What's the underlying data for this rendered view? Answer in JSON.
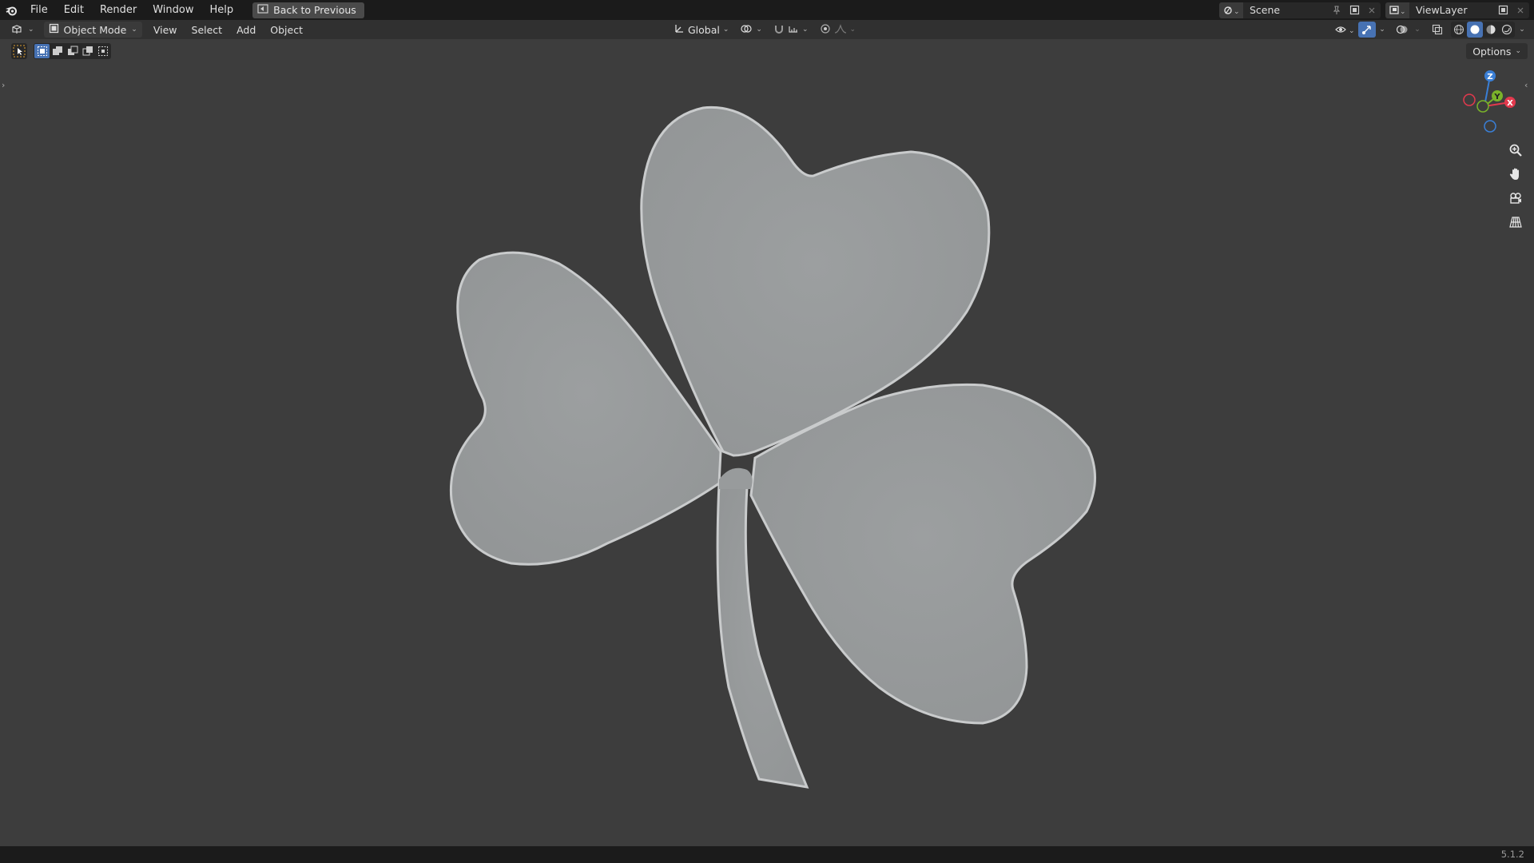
{
  "topbar": {
    "menus": [
      "File",
      "Edit",
      "Render",
      "Window",
      "Help"
    ],
    "back_label": "Back to Previous",
    "scene_name": "Scene",
    "view_layer_name": "ViewLayer"
  },
  "header": {
    "mode_label": "Object Mode",
    "menus": [
      "View",
      "Select",
      "Add",
      "Object"
    ],
    "transform_orientation": "Global",
    "options_label": "Options"
  },
  "gizmo": {
    "z_label": "Z",
    "y_label": "Y",
    "x_label": "X",
    "colors": {
      "x": "#e2394d",
      "y": "#7ab32a",
      "z": "#3a7fd6"
    }
  },
  "status": {
    "version": "5.1.2"
  },
  "colors": {
    "viewport_bg": "#3d3d3d",
    "object_fill": "#989b9c",
    "accent": "#4772b3"
  }
}
